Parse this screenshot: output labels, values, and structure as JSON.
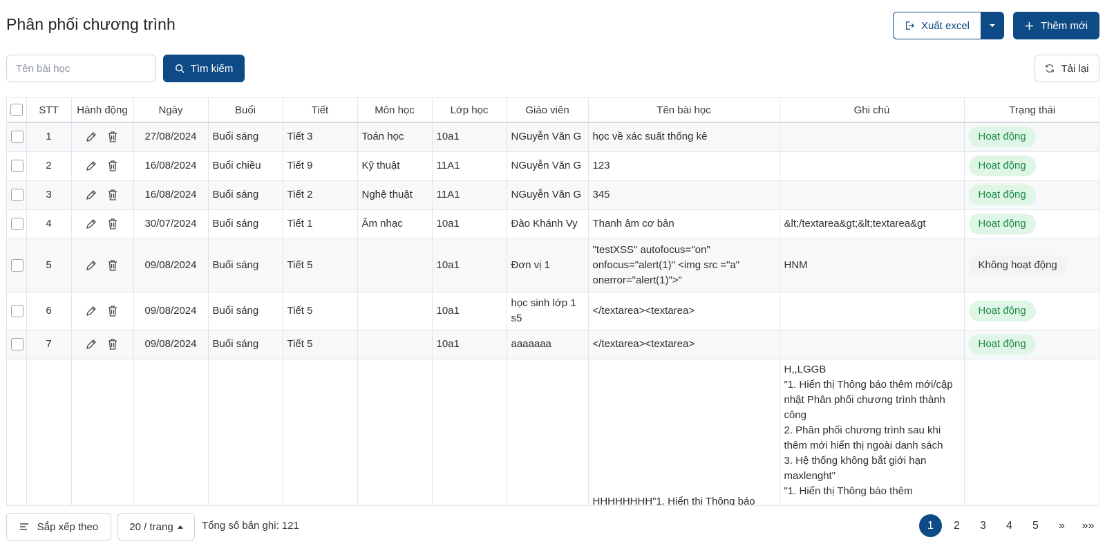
{
  "header": {
    "title": "Phân phối chương trình",
    "export_label": "Xuất excel",
    "add_label": "Thêm mới"
  },
  "toolbar": {
    "search_placeholder": "Tên bài học",
    "search_label": "Tìm kiếm",
    "reload_label": "Tải lại"
  },
  "table": {
    "columns": [
      "STT",
      "Hành động",
      "Ngày",
      "Buổi",
      "Tiết",
      "Môn học",
      "Lớp học",
      "Giáo viên",
      "Tên bài học",
      "Ghi chú",
      "Trạng thái"
    ],
    "rows": [
      {
        "stt": "1",
        "date": "27/08/2024",
        "session": "Buổi sáng",
        "period": "Tiết 3",
        "subject": "Toán học",
        "class": "10a1",
        "teacher": "NGuyễn Văn G",
        "lesson": "học về xác suất thống kê",
        "note": "",
        "status": "Hoạt động",
        "status_type": "active"
      },
      {
        "stt": "2",
        "date": "16/08/2024",
        "session": "Buổi chiều",
        "period": "Tiết 9",
        "subject": "Kỹ thuật",
        "class": "11A1",
        "teacher": "NGuyễn Văn G",
        "lesson": "123",
        "note": "",
        "status": "Hoạt động",
        "status_type": "active"
      },
      {
        "stt": "3",
        "date": "16/08/2024",
        "session": "Buổi sáng",
        "period": "Tiết 2",
        "subject": "Nghệ thuật",
        "class": "11A1",
        "teacher": "NGuyễn Văn G",
        "lesson": "345",
        "note": "",
        "status": "Hoạt động",
        "status_type": "active"
      },
      {
        "stt": "4",
        "date": "30/07/2024",
        "session": "Buổi sáng",
        "period": "Tiết 1",
        "subject": "Âm nhạc",
        "class": "10a1",
        "teacher": "Đào Khánh Vy",
        "lesson": "Thanh âm cơ bản",
        "note": "&lt;/textarea&gt;&lt;textarea&gt",
        "status": "Hoạt động",
        "status_type": "active"
      },
      {
        "stt": "5",
        "date": "09/08/2024",
        "session": "Buổi sáng",
        "period": "Tiết 5",
        "subject": "",
        "class": "10a1",
        "teacher": "Đơn vị 1",
        "lesson": "\"testXSS\" autofocus=\"on\" onfocus=\"alert(1)\" <img src =\"a\" onerror=\"alert(1)\">\"",
        "note": "HNM",
        "status": "Không hoạt động",
        "status_type": "inactive"
      },
      {
        "stt": "6",
        "date": "09/08/2024",
        "session": "Buổi sáng",
        "period": "Tiết 5",
        "subject": "",
        "class": "10a1",
        "teacher": "học sinh lớp 1 s5",
        "lesson": "</textarea><textarea>",
        "note": "",
        "status": "Hoạt động",
        "status_type": "active"
      },
      {
        "stt": "7",
        "date": "09/08/2024",
        "session": "Buổi sáng",
        "period": "Tiết 5",
        "subject": "",
        "class": "10a1",
        "teacher": "aaaaaaa",
        "lesson": "</textarea><textarea>",
        "note": "",
        "status": "Hoạt động",
        "status_type": "active"
      },
      {
        "stt": "",
        "date": "",
        "session": "",
        "period": "",
        "subject": "",
        "class": "",
        "teacher": "",
        "lesson": "HHHHHHHH\"1. Hiển thị Thông báo",
        "note": "H,,LGGB\n\"1. Hiển thị Thông báo thêm mới/cập nhật Phân phối chương trình thành công\n2. Phân phối chương trình sau khi thêm mới hiển thị ngoài danh sách\n3. Hệ thống không bắt giới hạn maxlenght\"\n\"1. Hiển thị Thông báo thêm",
        "status": "",
        "status_type": ""
      }
    ]
  },
  "footer": {
    "sort_label": "Sắp xếp theo",
    "page_size_label": "20 / trang",
    "total_text": "Tổng số bản ghi: 121",
    "pages": [
      "1",
      "2",
      "3",
      "4",
      "5"
    ],
    "current_page": "1",
    "next_label": "»",
    "last_label": "»»"
  },
  "colors": {
    "primary": "#0d4a86",
    "active_badge_bg": "#dff6e6",
    "active_badge_text": "#1a8a46"
  }
}
